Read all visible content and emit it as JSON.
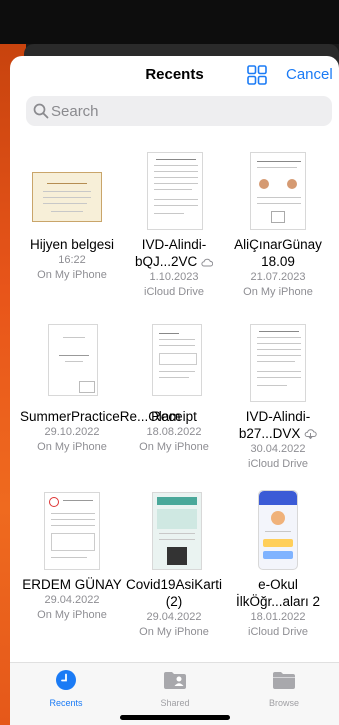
{
  "header": {
    "title": "Recents",
    "cancel_label": "Cancel"
  },
  "search": {
    "placeholder": "Search"
  },
  "files": [
    {
      "name": "Hijyen belgesi",
      "date": "16:22",
      "location": "On My iPhone"
    },
    {
      "name": "IVD-Alindi-bQJ...2VC",
      "date": "1.10.2023",
      "location": "iCloud Drive",
      "cloud": "cloud-icon"
    },
    {
      "name": "AliÇınarGünay 18.09",
      "date": "21.07.2023",
      "location": "On My iPhone"
    },
    {
      "name": "SummerPracticeRe...Olam",
      "date": "29.10.2022",
      "location": "On My iPhone"
    },
    {
      "name": "Receipt",
      "date": "18.08.2022",
      "location": "On My iPhone"
    },
    {
      "name": "IVD-Alindi-b27...DVX",
      "date": "30.04.2022",
      "location": "iCloud Drive",
      "cloud": "cloud-download-icon"
    },
    {
      "name": "ERDEM GÜNAY",
      "date": "29.04.2022",
      "location": "On My iPhone"
    },
    {
      "name": "Covid19AsiKarti (2)",
      "date": "29.04.2022",
      "location": "On My iPhone"
    },
    {
      "name": "e-Okul İlkÖğr...aları 2",
      "date": "18.01.2022",
      "location": "iCloud Drive"
    }
  ],
  "tabs": [
    {
      "label": "Recents",
      "icon": "clock-icon",
      "active": true
    },
    {
      "label": "Shared",
      "icon": "shared-folder-icon",
      "active": false
    },
    {
      "label": "Browse",
      "icon": "folder-icon",
      "active": false
    }
  ],
  "colors": {
    "accent": "#1b7bf5",
    "secondary_text": "#8e8e93",
    "side_background": "#e8551a"
  }
}
